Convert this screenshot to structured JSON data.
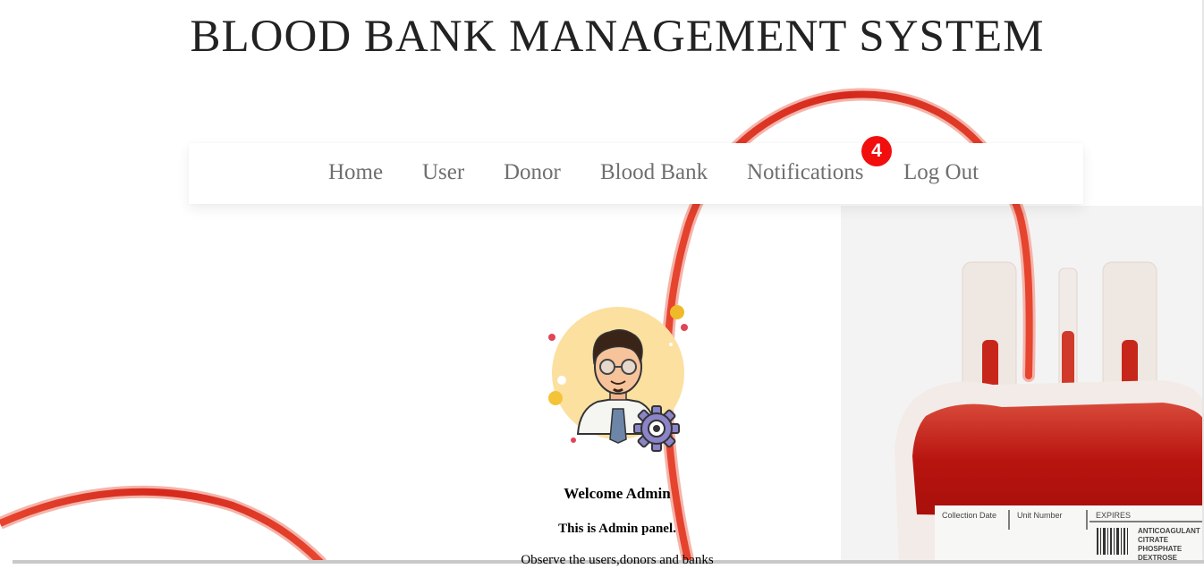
{
  "header": {
    "title": "BLOOD BANK MANAGEMENT SYSTEM"
  },
  "nav": {
    "home": "Home",
    "user": "User",
    "donor": "Donor",
    "blood_bank": "Blood Bank",
    "notifications": "Notifications",
    "notifications_count": "4",
    "logout": "Log Out"
  },
  "main": {
    "welcome": "Welcome Admin",
    "panel": "This is Admin panel.",
    "observe": "Observe the users,donors and banks"
  },
  "bag_label": {
    "collection_date": "Collection Date",
    "unit_number": "Unit Number",
    "expires": "EXPIRES",
    "anticoagulant": [
      "ANTICOAGULANT",
      "CITRATE",
      "PHOSPHATE",
      "DEXTROSE"
    ]
  },
  "colors": {
    "accent_red": "#f30e0e",
    "blood": "#c4120c",
    "avatar_bg": "#fbe0a0"
  },
  "icons": {
    "avatar": "admin-avatar-icon",
    "gear": "gear-icon"
  }
}
